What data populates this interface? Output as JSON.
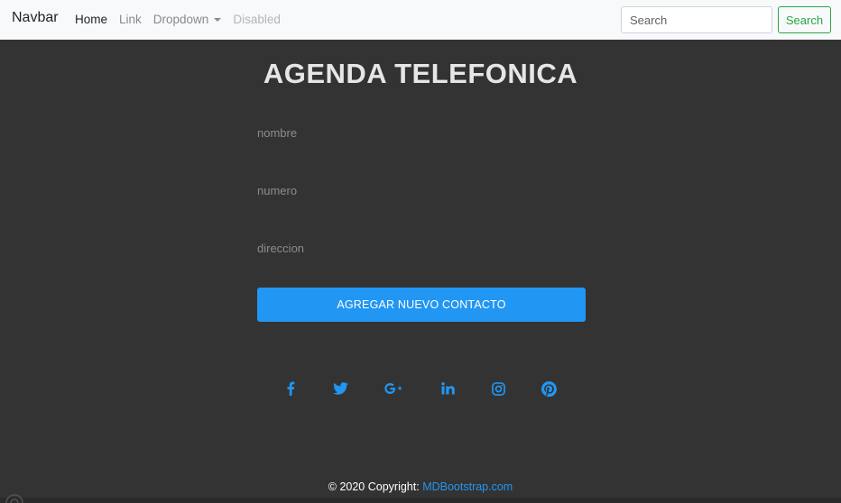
{
  "navbar": {
    "brand": "Navbar",
    "links": [
      {
        "label": "Home"
      },
      {
        "label": "Link"
      },
      {
        "label": "Dropdown"
      },
      {
        "label": "Disabled"
      }
    ],
    "search": {
      "placeholder": "Search",
      "button_label": "Search"
    }
  },
  "main": {
    "title": "AGENDA TELEFONICA",
    "fields": [
      {
        "placeholder": "nombre"
      },
      {
        "placeholder": "numero"
      },
      {
        "placeholder": "direccion"
      }
    ],
    "submit_label": "AGREGAR NUEVO CONTACTO"
  },
  "social": [
    {
      "icon": "facebook-icon"
    },
    {
      "icon": "twitter-icon"
    },
    {
      "icon": "google-plus-icon"
    },
    {
      "icon": "linkedin-icon"
    },
    {
      "icon": "instagram-icon"
    },
    {
      "icon": "pinterest-icon"
    }
  ],
  "footer": {
    "copyright": "© 2020 Copyright: ",
    "link": "MDBootstrap.com"
  },
  "colors": {
    "background": "#333333",
    "accent": "#2196f3",
    "search_green": "#28a745"
  }
}
